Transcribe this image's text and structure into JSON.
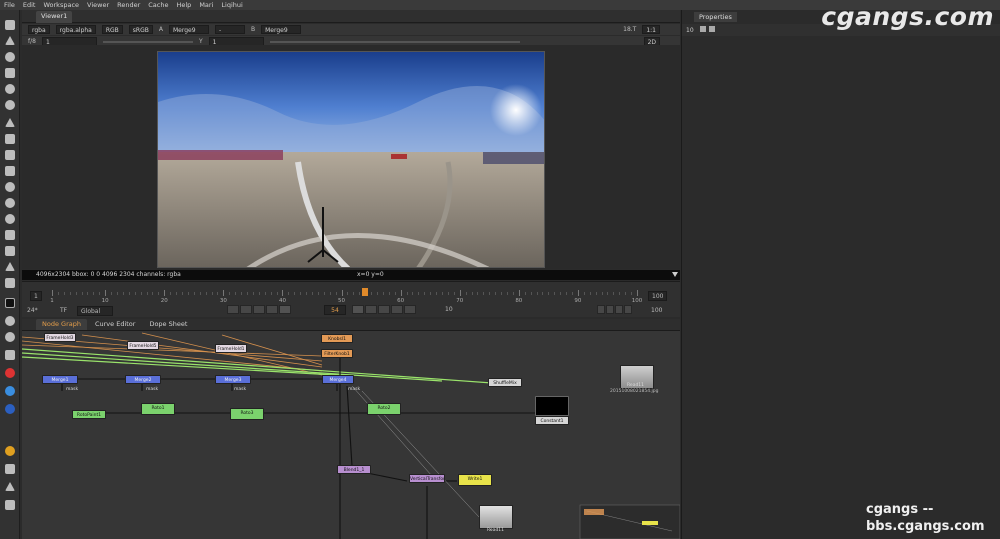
{
  "menu": [
    "File",
    "Edit",
    "Workspace",
    "Viewer",
    "Render",
    "Cache",
    "Help",
    "Mari",
    "Liqihui"
  ],
  "watermark": {
    "top": "cgangs.com",
    "bottom_line1": "cgangs    --",
    "bottom_line2": "bbs.cgangs.com"
  },
  "viewer": {
    "tab": "Viewer1",
    "controls": {
      "channels": "rgba",
      "alpha": "rgba.alpha",
      "space": "RGB",
      "colorspace": "sRGB",
      "a_input": "Merge9",
      "a_sep": "-",
      "b_input": "Merge9",
      "zoom": "1:1",
      "fstop_val": "18.T",
      "view_mode": "2D"
    },
    "row2": {
      "fstop": "f/8",
      "fstop_num": "1",
      "y_label": "Y",
      "y_val": "1"
    },
    "status_left": "4096x2304  bbox: 0 0 4096 2304 channels: rgba",
    "status_center": "x=0 y=0"
  },
  "timeline": {
    "start": "1",
    "end": "100",
    "current": "54",
    "fps": "24*",
    "tf": "TF",
    "scope": "Global",
    "step": "10",
    "ticks": [
      "1",
      "10",
      "20",
      "30",
      "40",
      "50",
      "60",
      "70",
      "80",
      "90",
      "100"
    ]
  },
  "nodegraph": {
    "tabs": [
      "Node Graph",
      "Curve Editor",
      "Dope Sheet"
    ],
    "mask_label": "mask",
    "nodes": {
      "frameheld3": "FrameHold3",
      "frameheld5": "FrameHold5",
      "frameheld1": "FrameHold1",
      "knob": "Knobsl1",
      "filterknob": "FilterKnob1",
      "merge_a": "Merge1",
      "merge_b": "Merge2",
      "merge_c": "Merge3",
      "merge_d": "Merge4",
      "shufflemix": "ShuffleMix",
      "read_top": "Read11",
      "read_top_sub": "20151008021854.jpg",
      "rotopaint": "RotoPaint1",
      "roto1": "Roto1",
      "roto2": "Roto2",
      "roto3": "Roto3",
      "constant": "Constant1",
      "blend": "Blend1_1",
      "vertical": "VerticalTransform",
      "write": "Write1",
      "read_bottom": "Read11"
    }
  },
  "properties": {
    "title": "Properties",
    "count": "10"
  }
}
